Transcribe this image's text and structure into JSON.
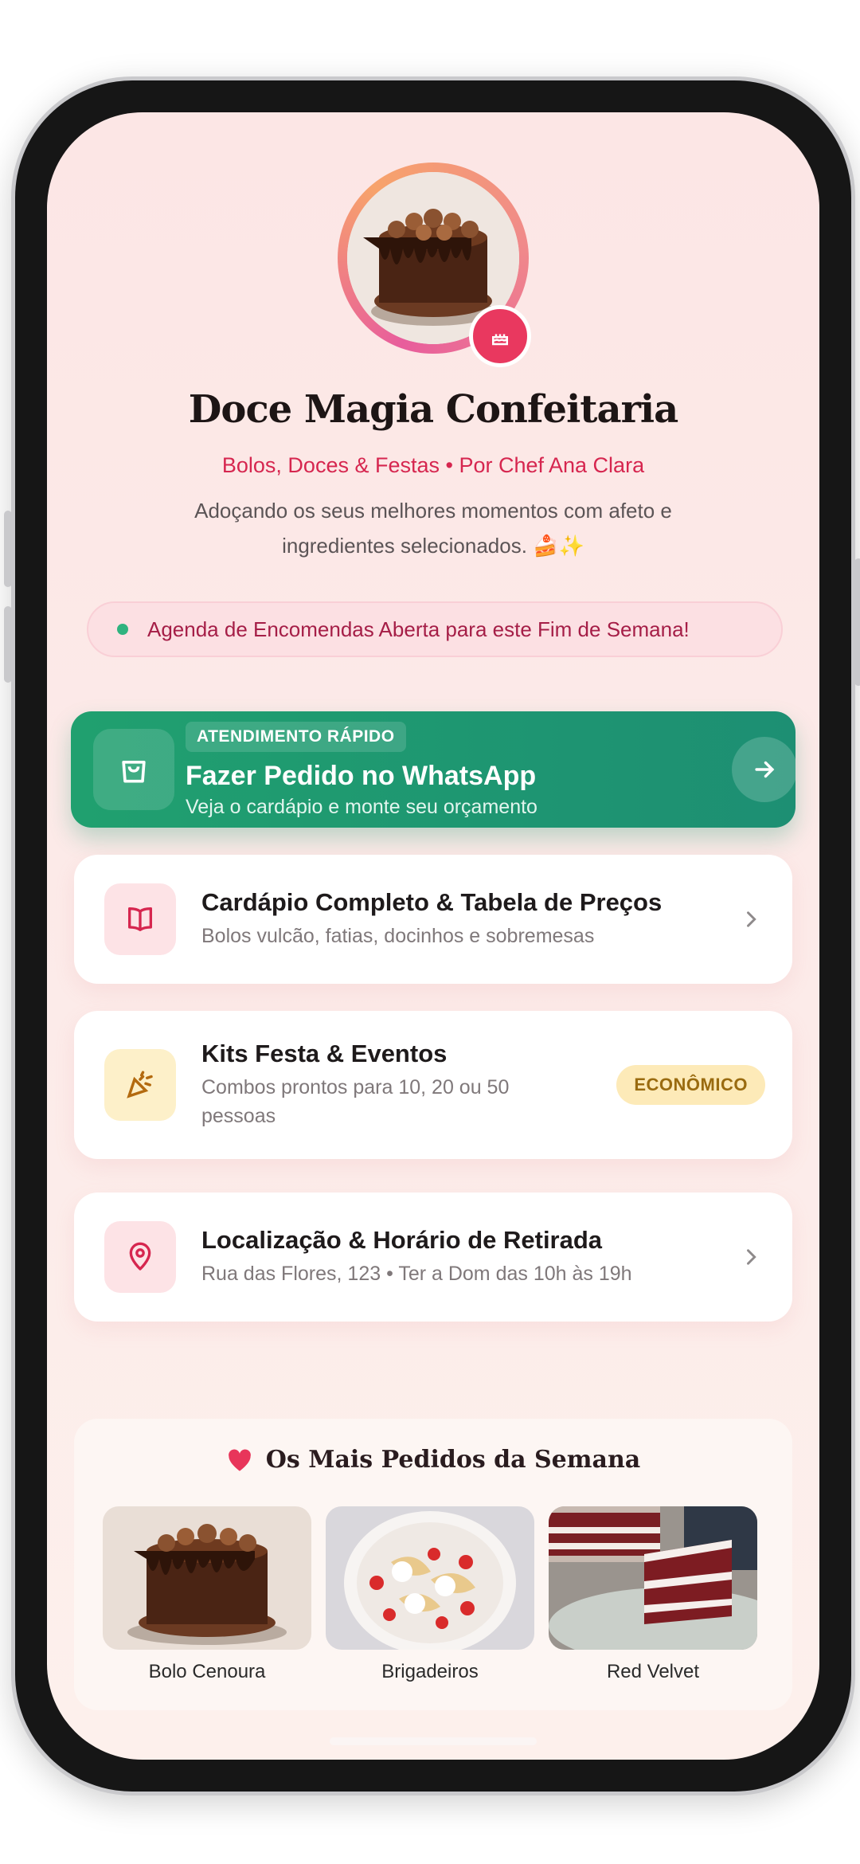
{
  "profile": {
    "name": "Doce Magia Confeitaria",
    "tagline": "Bolos, Doces & Festas • Por Chef Ana Clara",
    "bio": "Adoçando os seus melhores momentos com afeto e ingredientes selecionados. 🍰✨",
    "avatar_icon": "cake-photo",
    "badge_icon": "birthday-cake-icon"
  },
  "notice": {
    "text": "Agenda de Encomendas Aberta para este Fim de Semana!",
    "status_color": "#2fb37f"
  },
  "whatsapp": {
    "tag": "ATENDIMENTO RÁPIDO",
    "title": "Fazer Pedido no WhatsApp",
    "subtitle": "Veja o cardápio e monte seu orçamento",
    "icon": "shopping-bag-icon",
    "color": "#20a06f"
  },
  "links": [
    {
      "title": "Cardápio Completo & Tabela de Preços",
      "subtitle": "Bolos vulcão, fatias, docinhos e sobremesas",
      "icon": "book-icon"
    },
    {
      "title": "Kits Festa & Eventos",
      "subtitle": "Combos prontos para 10, 20 ou 50 pessoas",
      "icon": "party-popper-icon",
      "badge": "ECONÔMICO"
    },
    {
      "title": "Localização & Horário de Retirada",
      "subtitle": "Rua das Flores, 123 • Ter a Dom das 10h às 19h",
      "icon": "map-pin-icon"
    }
  ],
  "favorites": {
    "title": "Os Mais Pedidos da Semana",
    "icon": "heart-icon",
    "items": [
      {
        "label": "Bolo Cenoura"
      },
      {
        "label": "Brigadeiros"
      },
      {
        "label": "Red Velvet"
      }
    ]
  },
  "colors": {
    "accent": "#d6264f",
    "brand_green": "#20a06f",
    "background": "#fce6e5"
  }
}
